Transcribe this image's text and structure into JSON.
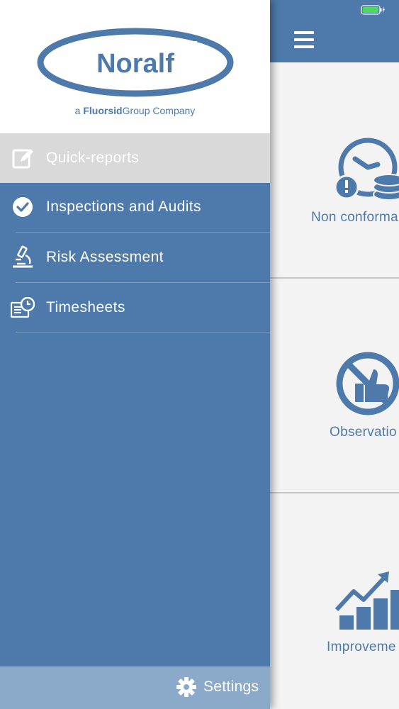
{
  "brand": {
    "name": "Noralf",
    "tagline_prefix": "a ",
    "tagline_bold": "Fluorsid",
    "tagline_suffix": "Group Company"
  },
  "menu": {
    "items": [
      {
        "label": "Quick-reports",
        "icon": "edit-icon",
        "active": true
      },
      {
        "label": "Inspections and Audits",
        "icon": "check-circle-icon",
        "active": false
      },
      {
        "label": "Risk Assessment",
        "icon": "microscope-icon",
        "active": false
      },
      {
        "label": "Timesheets",
        "icon": "timesheet-clock-icon",
        "active": false
      }
    ]
  },
  "settings": {
    "label": "Settings",
    "icon": "gear-icon"
  },
  "main": {
    "menu_icon": "hamburger-icon",
    "cards": [
      {
        "label": "Non conforma",
        "icon": "clock-coins-warning-icon"
      },
      {
        "label": "Observatio",
        "icon": "no-thumbs-up-icon"
      },
      {
        "label": "Improveme",
        "icon": "growth-chart-icon"
      }
    ]
  },
  "status_bar": {
    "battery": "battery-charging-icon"
  },
  "colors": {
    "primary": "#4d7aab",
    "active_item": "#d9d9d9",
    "settings_bar": "#8ba9c9",
    "content_bg": "#f3f3f3",
    "battery": "#4cd964"
  }
}
